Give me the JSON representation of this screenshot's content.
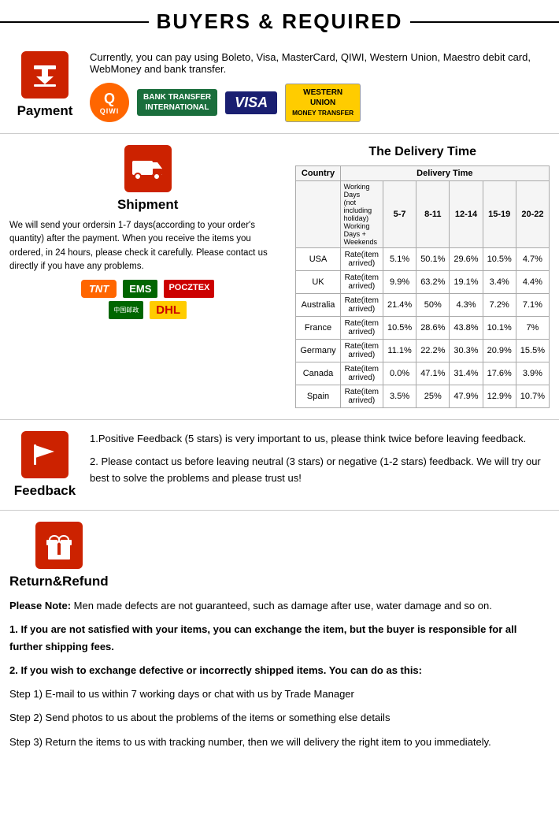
{
  "header": {
    "title": "BUYERS & REQUIRED"
  },
  "payment": {
    "section_label": "Payment",
    "description": "Currently, you can pay using Boleto, Visa, MasterCard, QIWI, Western Union, Maestro  debit card, WebMoney and bank transfer.",
    "logos": [
      {
        "name": "QIWI",
        "type": "qiwi"
      },
      {
        "name": "BANK TRANSFER\nINTERNATIONAL",
        "type": "bank"
      },
      {
        "name": "VISA",
        "type": "visa"
      },
      {
        "name": "WESTERN\nUNION\nMONEY TRANSFER",
        "type": "western"
      }
    ]
  },
  "shipment": {
    "section_label": "Shipment",
    "delivery_title": "The Delivery Time",
    "body_text": "We will send your ordersin 1-7 days(according to your order's quantity) after the payment. When you receive the items you ordered, in 24 hours, please check it carefully. Please contact us directly if you have any problems.",
    "table": {
      "col_country": "Country",
      "col_delivery": "Delivery Time",
      "col_working_days": "Working Days\n(not including holiday)\nWorking Days + Weekends",
      "ranges": [
        "5-7",
        "8-11",
        "12-14",
        "15-19",
        "20-22"
      ],
      "rows": [
        {
          "country": "USA",
          "label": "Rate(item arrived)",
          "values": [
            "5.1%",
            "50.1%",
            "29.6%",
            "10.5%",
            "4.7%"
          ]
        },
        {
          "country": "UK",
          "label": "Rate(item arrived)",
          "values": [
            "9.9%",
            "63.2%",
            "19.1%",
            "3.4%",
            "4.4%"
          ]
        },
        {
          "country": "Australia",
          "label": "Rate(item arrived)",
          "values": [
            "21.4%",
            "50%",
            "4.3%",
            "7.2%",
            "7.1%"
          ]
        },
        {
          "country": "France",
          "label": "Rate(item arrived)",
          "values": [
            "10.5%",
            "28.6%",
            "43.8%",
            "10.1%",
            "7%"
          ]
        },
        {
          "country": "Germany",
          "label": "Rate(item arrived)",
          "values": [
            "11.1%",
            "22.2%",
            "30.3%",
            "20.9%",
            "15.5%"
          ]
        },
        {
          "country": "Canada",
          "label": "Rate(item arrived)",
          "values": [
            "0.0%",
            "47.1%",
            "31.4%",
            "17.6%",
            "3.9%"
          ]
        },
        {
          "country": "Spain",
          "label": "Rate(item arrived)",
          "values": [
            "3.5%",
            "25%",
            "47.9%",
            "12.9%",
            "10.7%"
          ]
        }
      ]
    },
    "carriers": [
      "TNT",
      "EMS",
      "POCZTEX",
      "China Post",
      "DHL"
    ]
  },
  "feedback": {
    "section_label": "Feedback",
    "point1": "1.Positive Feedback (5 stars) is very important to us, please think twice before leaving feedback.",
    "point2": "2. Please contact us before leaving neutral (3 stars) or negative  (1-2 stars) feedback. We will try our best to solve the problems and please trust us!"
  },
  "return_refund": {
    "section_label": "Return&Refund",
    "note": "Please Note:",
    "note_text": " Men made defects are not guaranteed, such as damage after use, water damage and so on.",
    "point1": "1. If you are not satisfied with your items, you can exchange the item, but the buyer is responsible for all further shipping fees.",
    "point2": "2. If you wish to exchange defective or incorrectly shipped items. You can do as this:",
    "steps": [
      "Step 1) E-mail to us within 7 working days or chat with us by Trade Manager",
      "Step 2) Send photos to us about the problems of the items or something else details",
      "Step 3) Return the items to us with tracking number, then we will delivery the right item to you immediately."
    ]
  }
}
